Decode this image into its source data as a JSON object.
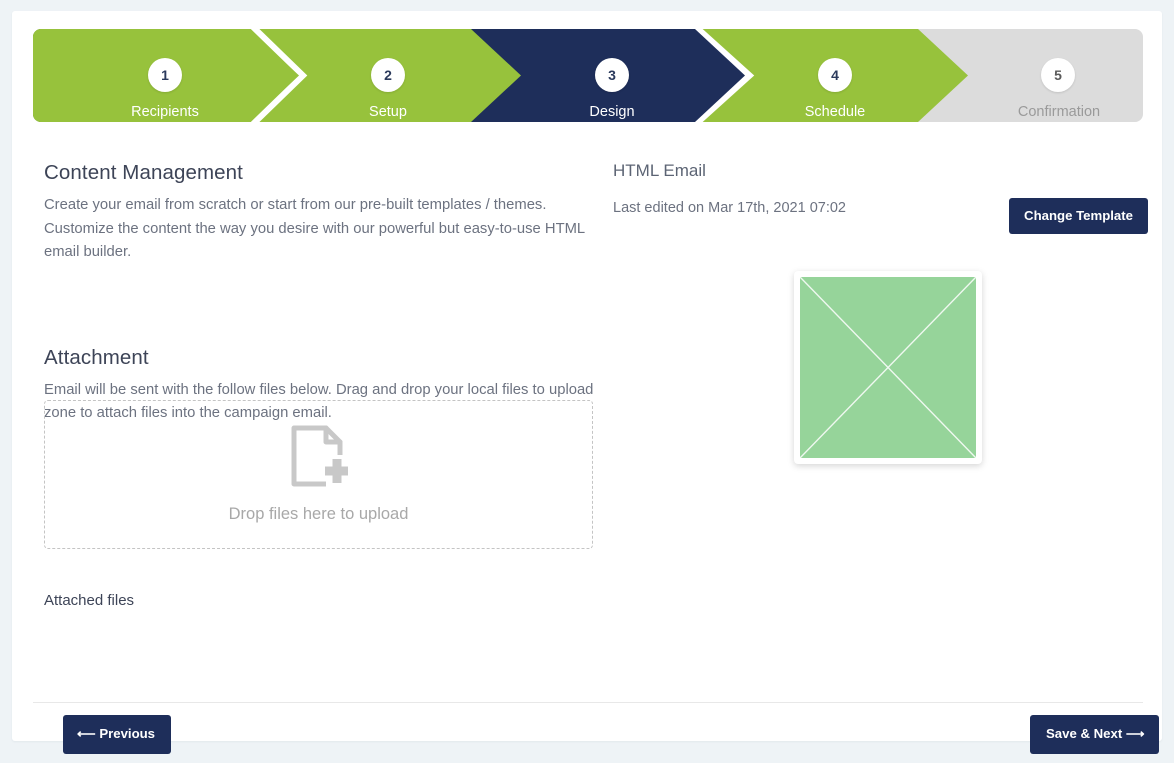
{
  "theme": {
    "green": "#97c23c",
    "navy": "#1e2e5a",
    "grey": "#dcdcdc",
    "page_bg": "#eef3f6",
    "thumb_green": "#96d49a",
    "heading": "#3d4457",
    "body_text": "#6c7280"
  },
  "stepper": {
    "steps": [
      {
        "number": "1",
        "label": "Recipients",
        "state": "complete"
      },
      {
        "number": "2",
        "label": "Setup",
        "state": "complete"
      },
      {
        "number": "3",
        "label": "Design",
        "state": "current"
      },
      {
        "number": "4",
        "label": "Schedule",
        "state": "complete"
      },
      {
        "number": "5",
        "label": "Confirmation",
        "state": "disabled"
      }
    ]
  },
  "content_management": {
    "title": "Content Management",
    "description": "Create your email from scratch or start from our pre-built templates / themes. Customize the content the way you desire with our powerful but easy-to-use HTML email builder."
  },
  "attachment": {
    "title": "Attachment",
    "description": "Email will be sent with the follow files below. Drag and drop your local files to upload zone to attach files into the campaign email.",
    "dropzone_text": "Drop files here to upload",
    "dropzone_icon": "file-plus-icon",
    "attached_files_title": "Attached files"
  },
  "email_panel": {
    "title": "HTML Email",
    "last_edited": "Last edited on Mar 17th, 2021 07:02",
    "change_template_label": "Change Template",
    "thumbnail_name": "template-thumbnail-placeholder"
  },
  "footer": {
    "previous_label": "Previous",
    "previous_icon": "arrow-left-icon",
    "next_label": "Save & Next",
    "next_icon": "arrow-right-icon"
  }
}
